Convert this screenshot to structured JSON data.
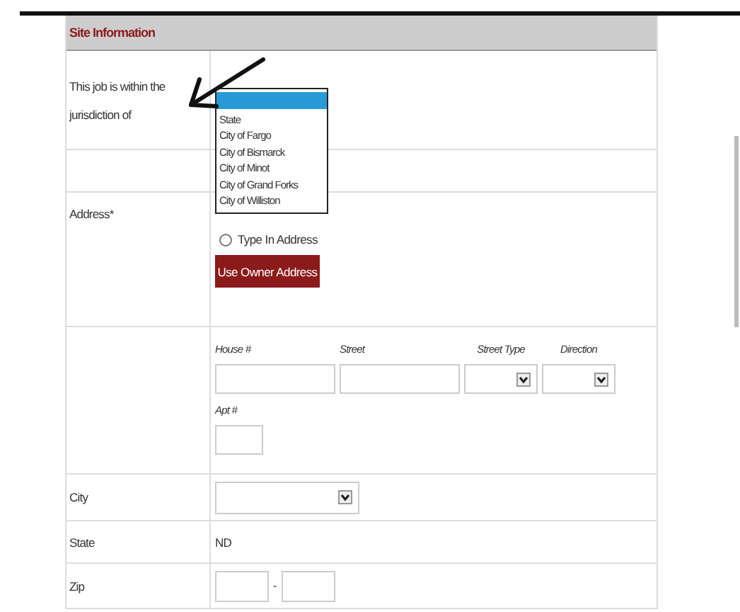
{
  "section": {
    "title": "Site Information"
  },
  "jurisdiction": {
    "label": "This job is within the jurisdiction of",
    "dropdown": {
      "expanded": true,
      "options": [
        {
          "selected": true
        },
        {
          "label": "State",
          "selected": false
        },
        {
          "label": "City of Fargo",
          "selected": false
        },
        {
          "label": "City of Bismarck",
          "selected": false
        },
        {
          "label": "City of Minot",
          "selected": false
        },
        {
          "label": "City of Grand Forks",
          "selected": false
        },
        {
          "label": "City of Williston",
          "selected": false
        }
      ]
    }
  },
  "address": {
    "label": "Address*",
    "radio": {
      "label": "Type In Address",
      "selected": false
    },
    "button": "Use Owner Address"
  },
  "address_fields": [
    {
      "kind": "text",
      "label": "House #"
    },
    {
      "kind": "text",
      "label": "Street"
    },
    {
      "kind": "select",
      "label": "Street Type"
    },
    {
      "kind": "select",
      "label": "Direction"
    },
    {
      "kind": "short",
      "label": "Apt #"
    }
  ],
  "city": {
    "label": "City"
  },
  "state": {
    "label": "State",
    "value": "ND"
  },
  "zip": {
    "label": "Zip",
    "separator": "-"
  }
}
